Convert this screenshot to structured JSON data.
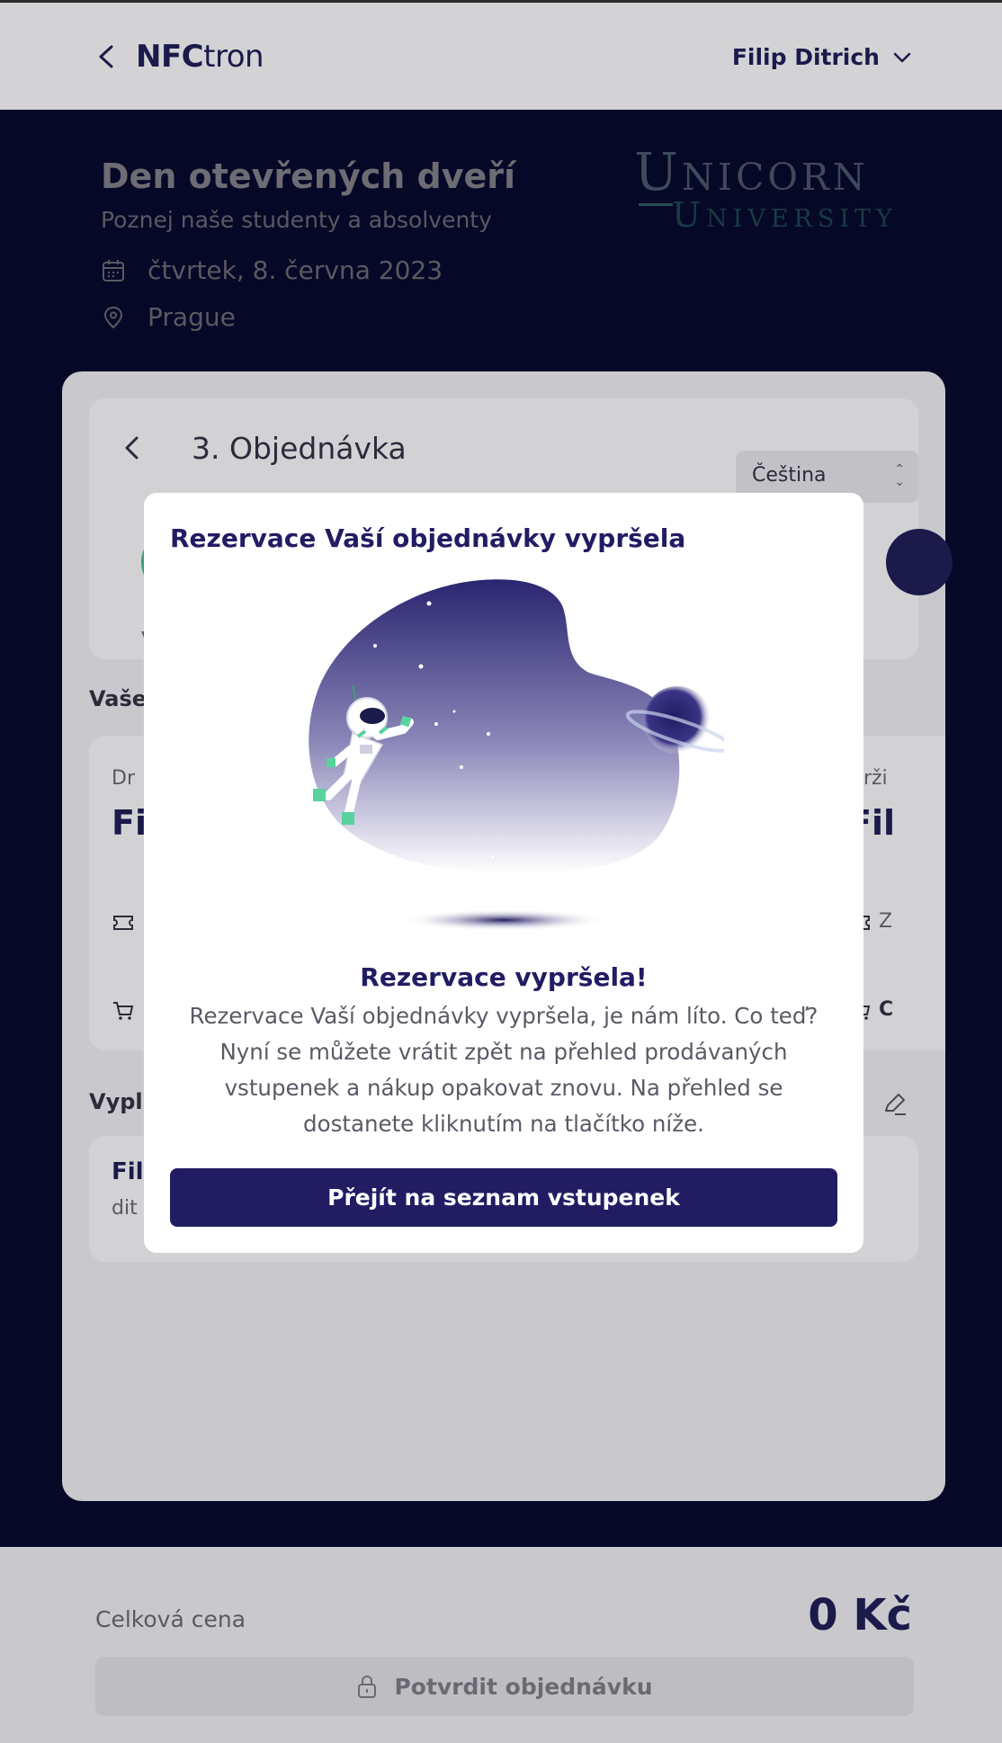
{
  "header": {
    "logo_bold": "NFC",
    "logo_light": "tron",
    "user_name": "Filip Ditrich"
  },
  "event": {
    "title": "Den otevřených dveří",
    "subtitle": "Poznej naše studenty a absolventy",
    "date": "čtvrtek, 8. června 2023",
    "place": "Prague",
    "organizer_logo_top": "Unicorn",
    "organizer_logo_bottom": "University"
  },
  "order": {
    "step_title": "3. Objednávka",
    "language": "Čeština",
    "partial_text": "Vy",
    "section_tickets_partial": "Vaše",
    "ticket_left_label_partial": "Dr",
    "ticket_left_name_partial": "Fi",
    "ticket_right_label_partial": "Drži",
    "ticket_right_name_partial": "Fil",
    "ticket_right_row1_partial": "Z",
    "ticket_right_row2_partial": "C",
    "section_filled_partial": "Vypl",
    "contact_name_partial": "Fil",
    "contact_email_partial": "dit"
  },
  "footer": {
    "total_label": "Celková cena",
    "total_value": "0 Kč",
    "confirm_label": "Potvrdit objednávku"
  },
  "modal": {
    "title": "Rezervace Vaší objednávky vypršela",
    "heading": "Rezervace vypršela!",
    "text": "Rezervace Vaší objednávky vypršela, je nám líto. Co teď? Nyní se můžete vrátit zpět na přehled prodávaných vstupenek a nákup opakovat znovu. Na přehled se dostanete kliknutím na tlačítko níže.",
    "button_label": "Přejít na seznam vstupenek"
  },
  "colors": {
    "brand_navy": "#221c63",
    "success_green": "#3c9d78",
    "overlay_dark": "#060827"
  }
}
